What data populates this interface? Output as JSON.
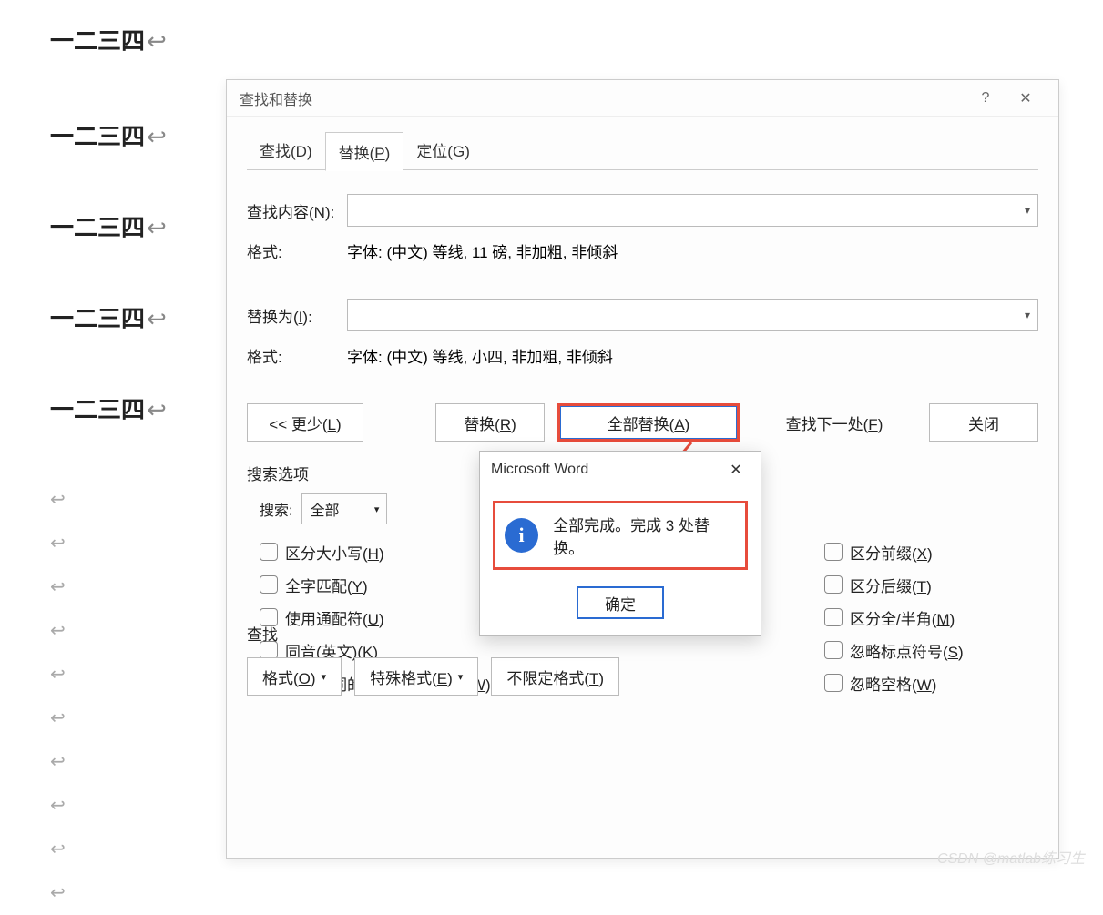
{
  "doc": {
    "lines": [
      "一二三四",
      "一二三四",
      "一二三四",
      "一二三四",
      "一二三四"
    ]
  },
  "dialog": {
    "title": "查找和替换",
    "tabs": {
      "find": "查找(D)",
      "replace": "替换(P)",
      "goto": "定位(G)"
    },
    "find_label": "查找内容(N):",
    "format_label": "格式:",
    "find_format": "字体: (中文) 等线, 11 磅, 非加粗, 非倾斜",
    "replace_label": "替换为(I):",
    "replace_format": "字体: (中文) 等线, 小四, 非加粗, 非倾斜",
    "buttons": {
      "less": "<< 更少(L)",
      "replace": "替换(R)",
      "replace_all": "全部替换(A)",
      "find_next": "查找下一处(F)",
      "close": "关闭"
    },
    "search_options": {
      "legend": "搜索选项",
      "search_label": "搜索:",
      "search_value": "全部",
      "left": {
        "match_case": "区分大小写(H)",
        "whole_word": "全字匹配(Y)",
        "wildcards": "使用通配符(U)",
        "sounds_like": "同音(英文)(K)",
        "all_forms": "查找单词的所有形式(英文)(W)"
      },
      "right": {
        "prefix": "区分前缀(X)",
        "suffix": "区分后缀(T)",
        "full_half": "区分全/半角(M)",
        "ignore_punct": "忽略标点符号(S)",
        "ignore_space": "忽略空格(W)"
      }
    },
    "bottom": {
      "legend": "查找",
      "format_btn": "格式(O)",
      "special_btn": "特殊格式(E)",
      "no_format_btn": "不限定格式(T)"
    }
  },
  "msgbox": {
    "title": "Microsoft Word",
    "text": "全部完成。完成 3 处替换。",
    "ok": "确定"
  },
  "watermark": "CSDN @matlab练习生"
}
